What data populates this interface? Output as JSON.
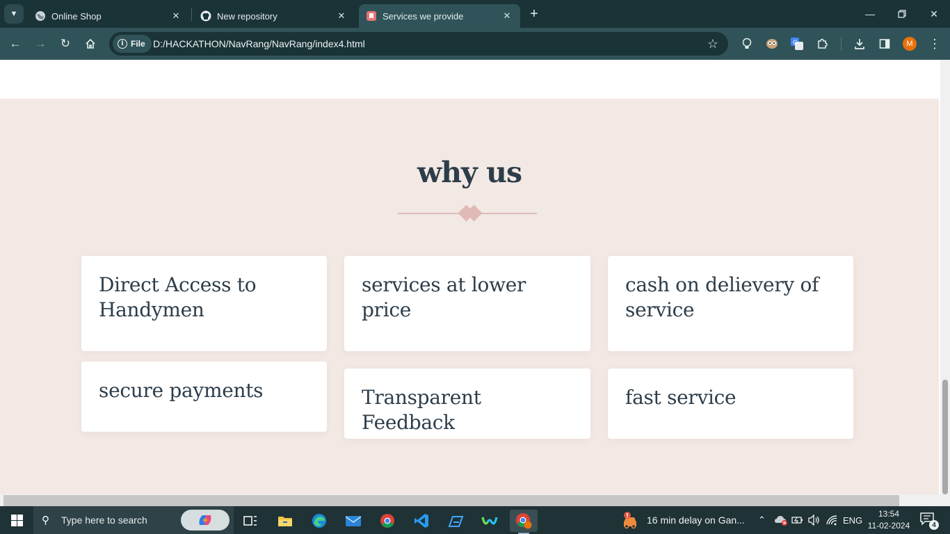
{
  "browser": {
    "tabs": [
      {
        "title": "Online Shop",
        "favicon": "globe-icon",
        "active": false
      },
      {
        "title": "New repository",
        "favicon": "github-icon",
        "active": false
      },
      {
        "title": "Services we provide",
        "favicon": "bookmark-page-icon",
        "active": true
      }
    ],
    "omnibox": {
      "chip_label": "File",
      "url": "D:/HACKATHON/NavRang/NavRang/index4.html"
    },
    "profile_initial": "M",
    "colors": {
      "tabstrip": "#1a3337",
      "toolbar": "#2f5358",
      "omnibox": "#1a3337"
    }
  },
  "page": {
    "section_title": "why us",
    "cards": [
      {
        "title": "Direct Access to Handymen"
      },
      {
        "title": "services at lower price"
      },
      {
        "title": "cash on delievery of service"
      },
      {
        "title": "secure payments"
      },
      {
        "title": "Transparent Feedback"
      },
      {
        "title": "fast service"
      }
    ],
    "colors": {
      "section_background": "#f3e9e4",
      "heading": "#2d3d4a",
      "divider": "#e1b9b6",
      "card": "#ffffff"
    }
  },
  "taskbar": {
    "search_placeholder": "Type here to search",
    "pinned_apps": [
      "task-view-icon",
      "file-explorer-icon",
      "edge-icon",
      "mail-icon",
      "chrome-icon",
      "vscode-icon",
      "app-icon",
      "webex-icon",
      "chrome-profile-icon"
    ],
    "news_text": "16 min delay on Gan...",
    "language": "ENG",
    "time": "13:54",
    "date": "11-02-2024",
    "notification_count": "4"
  }
}
